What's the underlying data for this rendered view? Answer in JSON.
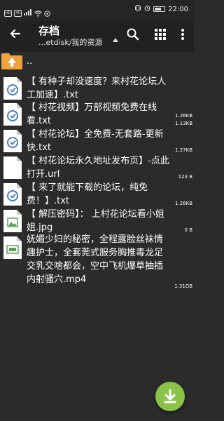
{
  "status_bar": {
    "left_chips": [
      "HD",
      "4G"
    ],
    "signal": "4G",
    "time": "22:00"
  },
  "toolbar": {
    "title": "存档",
    "path": "...etdisk/我的资源"
  },
  "parent_row": {
    "label": ".."
  },
  "files": [
    {
      "name": "【 有种子却没速度？来村花论坛人工加速】.txt",
      "size": "1.26KB",
      "icon": "text-file-icon"
    },
    {
      "name": "【 村花视频】万部视频免费在线看.txt",
      "size": "1.13KB",
      "icon": "text-file-icon"
    },
    {
      "name": "【 村花论坛】全免费-无套路-更新快.txt",
      "size": "1.27KB",
      "icon": "text-file-icon"
    },
    {
      "name": "【 村花论坛永久地址发布页】-点此打开.url",
      "size": "123 B",
      "icon": "blank-file-icon"
    },
    {
      "name": "【 来了就能下载的论坛，纯免费！】.txt",
      "size": "1.26KB",
      "icon": "text-file-icon"
    },
    {
      "name": "【 解压密码】： 上村花论坛看小姐姐.jpg",
      "size": "0 B",
      "icon": "image-file-icon"
    },
    {
      "name": "妩媚少妇的秘密，全程露脸丝袜情趣护士，全套莞式服务胸推毒龙足交乳交啥都会，空中飞机爆草抽插内射骚穴.mp4",
      "size": "1.31GB",
      "icon": "video-file-icon"
    }
  ],
  "colors": {
    "fab": "#8bc34a",
    "folder": "#f0a23b",
    "background": "#2b2b2b",
    "toolbar": "#212121"
  }
}
